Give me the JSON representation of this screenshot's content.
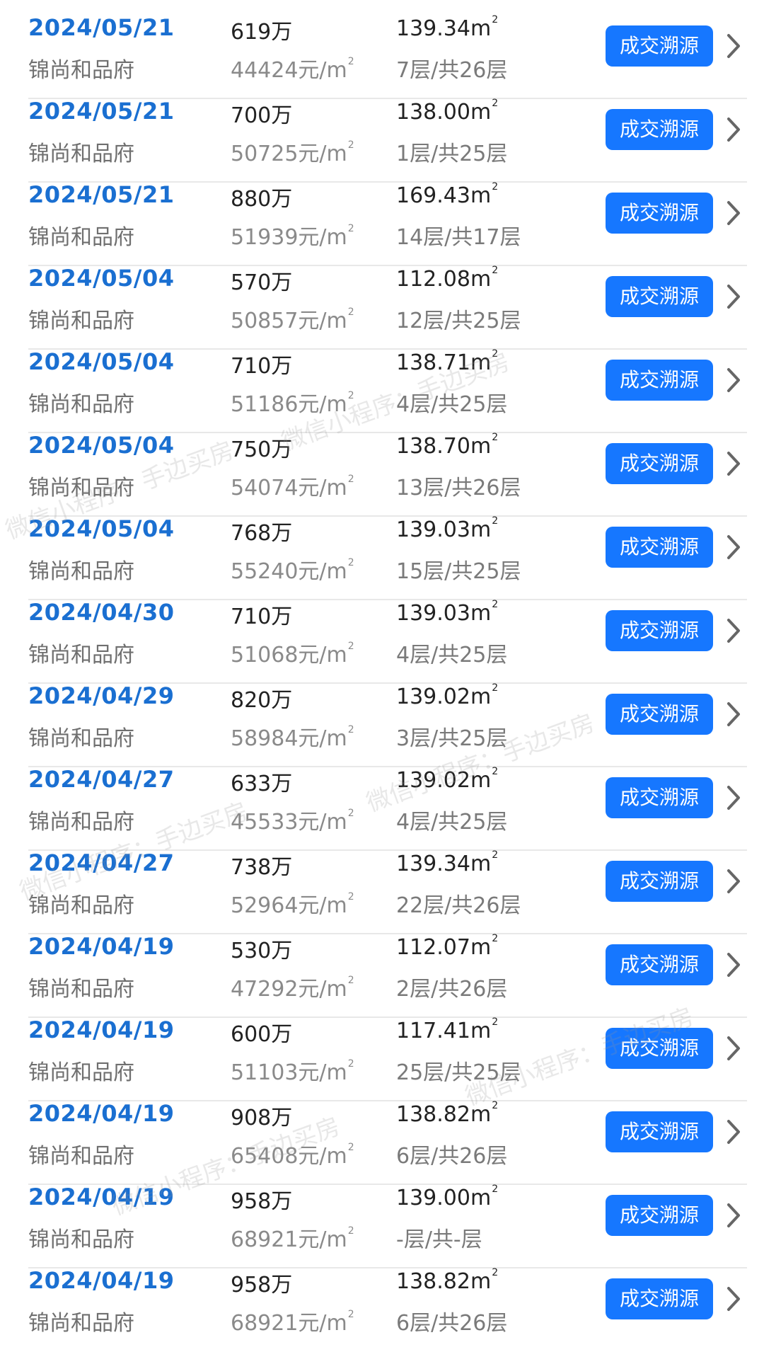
{
  "button_label": "成交溯源",
  "watermark_text": "微信小程序：手边买房",
  "colors": {
    "date": "#1a6fd1",
    "button_bg": "#1677ff",
    "divider": "#e8e8e8"
  },
  "records": [
    {
      "date": "2024/05/21",
      "name": "锦尚和品府",
      "price": "619万",
      "unit_price": "44424元/m",
      "area": "139.34m",
      "floor": "7层/共26层"
    },
    {
      "date": "2024/05/21",
      "name": "锦尚和品府",
      "price": "700万",
      "unit_price": "50725元/m",
      "area": "138.00m",
      "floor": "1层/共25层"
    },
    {
      "date": "2024/05/21",
      "name": "锦尚和品府",
      "price": "880万",
      "unit_price": "51939元/m",
      "area": "169.43m",
      "floor": "14层/共17层"
    },
    {
      "date": "2024/05/04",
      "name": "锦尚和品府",
      "price": "570万",
      "unit_price": "50857元/m",
      "area": "112.08m",
      "floor": "12层/共25层"
    },
    {
      "date": "2024/05/04",
      "name": "锦尚和品府",
      "price": "710万",
      "unit_price": "51186元/m",
      "area": "138.71m",
      "floor": "4层/共25层"
    },
    {
      "date": "2024/05/04",
      "name": "锦尚和品府",
      "price": "750万",
      "unit_price": "54074元/m",
      "area": "138.70m",
      "floor": "13层/共26层"
    },
    {
      "date": "2024/05/04",
      "name": "锦尚和品府",
      "price": "768万",
      "unit_price": "55240元/m",
      "area": "139.03m",
      "floor": "15层/共25层"
    },
    {
      "date": "2024/04/30",
      "name": "锦尚和品府",
      "price": "710万",
      "unit_price": "51068元/m",
      "area": "139.03m",
      "floor": "4层/共25层"
    },
    {
      "date": "2024/04/29",
      "name": "锦尚和品府",
      "price": "820万",
      "unit_price": "58984元/m",
      "area": "139.02m",
      "floor": "3层/共25层"
    },
    {
      "date": "2024/04/27",
      "name": "锦尚和品府",
      "price": "633万",
      "unit_price": "45533元/m",
      "area": "139.02m",
      "floor": "4层/共25层"
    },
    {
      "date": "2024/04/27",
      "name": "锦尚和品府",
      "price": "738万",
      "unit_price": "52964元/m",
      "area": "139.34m",
      "floor": "22层/共26层"
    },
    {
      "date": "2024/04/19",
      "name": "锦尚和品府",
      "price": "530万",
      "unit_price": "47292元/m",
      "area": "112.07m",
      "floor": "2层/共26层"
    },
    {
      "date": "2024/04/19",
      "name": "锦尚和品府",
      "price": "600万",
      "unit_price": "51103元/m",
      "area": "117.41m",
      "floor": "25层/共25层"
    },
    {
      "date": "2024/04/19",
      "name": "锦尚和品府",
      "price": "908万",
      "unit_price": "65408元/m",
      "area": "138.82m",
      "floor": "6层/共26层"
    },
    {
      "date": "2024/04/19",
      "name": "锦尚和品府",
      "price": "958万",
      "unit_price": "68921元/m",
      "area": "139.00m",
      "floor": "-层/共-层"
    },
    {
      "date": "2024/04/19",
      "name": "锦尚和品府",
      "price": "958万",
      "unit_price": "68921元/m",
      "area": "138.82m",
      "floor": "6层/共26层"
    }
  ]
}
